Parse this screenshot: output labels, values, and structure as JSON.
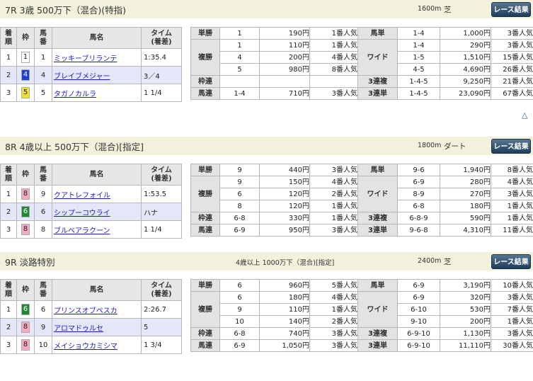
{
  "ui": {
    "result_button": "レース結果",
    "back_to_top": "△",
    "results_header": {
      "arrival": "着\n順",
      "frame": "枠",
      "horse_no": "馬\n番",
      "horse_name": "馬名",
      "time": "タイム\n(着差)"
    }
  },
  "races": [
    {
      "title": "7R 3歳 500万下（混合)(特指)",
      "conditions": "",
      "distance": "1600m",
      "surface": "芝",
      "results": [
        {
          "pos": "1",
          "frame": "1",
          "frame_color": "#ffffff",
          "frame_text_color": "#222222",
          "num": "1",
          "name": "ミッキーブリランテ",
          "time": "1:35.4"
        },
        {
          "pos": "2",
          "frame": "4",
          "frame_color": "#1c3fd6",
          "frame_text_color": "#ffffff",
          "num": "4",
          "name": "ブレイブメジャー",
          "time": "3／4"
        },
        {
          "pos": "3",
          "frame": "5",
          "frame_color": "#f5e12a",
          "frame_text_color": "#222222",
          "num": "5",
          "name": "タガノカルラ",
          "time": "1 1/4"
        }
      ],
      "payouts": {
        "tansho": {
          "label": "単勝",
          "rows": [
            {
              "combo": "1",
              "pay": "190円",
              "pop": "1番人気"
            }
          ]
        },
        "fukusho": {
          "label": "複勝",
          "rows": [
            {
              "combo": "1",
              "pay": "110円",
              "pop": "1番人気"
            },
            {
              "combo": "4",
              "pay": "200円",
              "pop": "4番人気"
            },
            {
              "combo": "5",
              "pay": "980円",
              "pop": "8番人気"
            }
          ]
        },
        "wakuren": {
          "label": "枠連",
          "rows": [
            {
              "combo": "",
              "pay": "",
              "pop": ""
            }
          ]
        },
        "umaren": {
          "label": "馬連",
          "rows": [
            {
              "combo": "1-4",
              "pay": "710円",
              "pop": "3番人気"
            }
          ]
        },
        "umatan": {
          "label": "馬単",
          "rows": [
            {
              "combo": "1-4",
              "pay": "1,000円",
              "pop": "3番人気"
            }
          ]
        },
        "wide": {
          "label": "ワイド",
          "rows": [
            {
              "combo": "1-4",
              "pay": "290円",
              "pop": "3番人気"
            },
            {
              "combo": "1-5",
              "pay": "1,510円",
              "pop": "15番人気"
            },
            {
              "combo": "4-5",
              "pay": "4,690円",
              "pop": "26番人気"
            }
          ]
        },
        "sanrenpuku": {
          "label": "3連複",
          "rows": [
            {
              "combo": "1-4-5",
              "pay": "9,250円",
              "pop": "21番人気"
            }
          ]
        },
        "sanrentan": {
          "label": "3連単",
          "rows": [
            {
              "combo": "1-4-5",
              "pay": "23,090円",
              "pop": "67番人気"
            }
          ]
        }
      }
    },
    {
      "title": "8R 4歳以上 500万下（混合)[指定]",
      "conditions": "",
      "distance": "1800m",
      "surface": "ダート",
      "results": [
        {
          "pos": "1",
          "frame": "8",
          "frame_color": "#f7a9bd",
          "frame_text_color": "#222222",
          "num": "9",
          "name": "クアトレフォイル",
          "time": "1:53.5"
        },
        {
          "pos": "2",
          "frame": "6",
          "frame_color": "#1d8a32",
          "frame_text_color": "#ffffff",
          "num": "6",
          "name": "シップーコウライ",
          "time": "ハナ"
        },
        {
          "pos": "3",
          "frame": "8",
          "frame_color": "#f7a9bd",
          "frame_text_color": "#222222",
          "num": "8",
          "name": "ブルベアラクーン",
          "time": "1 1/4"
        }
      ],
      "payouts": {
        "tansho": {
          "label": "単勝",
          "rows": [
            {
              "combo": "9",
              "pay": "440円",
              "pop": "3番人気"
            }
          ]
        },
        "fukusho": {
          "label": "複勝",
          "rows": [
            {
              "combo": "9",
              "pay": "150円",
              "pop": "4番人気"
            },
            {
              "combo": "6",
              "pay": "120円",
              "pop": "2番人気"
            },
            {
              "combo": "8",
              "pay": "120円",
              "pop": "1番人気"
            }
          ]
        },
        "wakuren": {
          "label": "枠連",
          "rows": [
            {
              "combo": "6-8",
              "pay": "330円",
              "pop": "1番人気"
            }
          ]
        },
        "umaren": {
          "label": "馬連",
          "rows": [
            {
              "combo": "6-9",
              "pay": "950円",
              "pop": "3番人気"
            }
          ]
        },
        "umatan": {
          "label": "馬単",
          "rows": [
            {
              "combo": "9-6",
              "pay": "1,940円",
              "pop": "8番人気"
            }
          ]
        },
        "wide": {
          "label": "ワイド",
          "rows": [
            {
              "combo": "6-9",
              "pay": "280円",
              "pop": "4番人気"
            },
            {
              "combo": "8-9",
              "pay": "270円",
              "pop": "3番人気"
            },
            {
              "combo": "6-8",
              "pay": "180円",
              "pop": "1番人気"
            }
          ]
        },
        "sanrenpuku": {
          "label": "3連複",
          "rows": [
            {
              "combo": "6-8-9",
              "pay": "590円",
              "pop": "1番人気"
            }
          ]
        },
        "sanrentan": {
          "label": "3連単",
          "rows": [
            {
              "combo": "9-6-8",
              "pay": "4,310円",
              "pop": "11番人気"
            }
          ]
        }
      }
    },
    {
      "title": "9R 淡路特別",
      "conditions": "4歳以上 1000万下（混合)[指定]",
      "distance": "2400m",
      "surface": "芝",
      "results": [
        {
          "pos": "1",
          "frame": "6",
          "frame_color": "#1d8a32",
          "frame_text_color": "#ffffff",
          "num": "6",
          "name": "プリンスオブペスカ",
          "time": "2:26.7"
        },
        {
          "pos": "2",
          "frame": "8",
          "frame_color": "#f7a9bd",
          "frame_text_color": "#222222",
          "num": "9",
          "name": "アロマドゥルセ",
          "time": "5"
        },
        {
          "pos": "3",
          "frame": "8",
          "frame_color": "#f7a9bd",
          "frame_text_color": "#222222",
          "num": "10",
          "name": "メイショウカミシマ",
          "time": "1 3/4"
        }
      ],
      "payouts": {
        "tansho": {
          "label": "単勝",
          "rows": [
            {
              "combo": "6",
              "pay": "960円",
              "pop": "5番人気"
            }
          ]
        },
        "fukusho": {
          "label": "複勝",
          "rows": [
            {
              "combo": "6",
              "pay": "180円",
              "pop": "4番人気"
            },
            {
              "combo": "9",
              "pay": "110円",
              "pop": "1番人気"
            },
            {
              "combo": "10",
              "pay": "140円",
              "pop": "2番人気"
            }
          ]
        },
        "wakuren": {
          "label": "枠連",
          "rows": [
            {
              "combo": "6-8",
              "pay": "740円",
              "pop": "3番人気"
            }
          ]
        },
        "umaren": {
          "label": "馬連",
          "rows": [
            {
              "combo": "6-9",
              "pay": "1,050円",
              "pop": "3番人気"
            }
          ]
        },
        "umatan": {
          "label": "馬単",
          "rows": [
            {
              "combo": "6-9",
              "pay": "3,190円",
              "pop": "10番人気"
            }
          ]
        },
        "wide": {
          "label": "ワイド",
          "rows": [
            {
              "combo": "6-9",
              "pay": "320円",
              "pop": "3番人気"
            },
            {
              "combo": "6-10",
              "pay": "530円",
              "pop": "7番人気"
            },
            {
              "combo": "9-10",
              "pay": "200円",
              "pop": "1番人気"
            }
          ]
        },
        "sanrenpuku": {
          "label": "3連複",
          "rows": [
            {
              "combo": "6-9-10",
              "pay": "1,130円",
              "pop": "3番人気"
            }
          ]
        },
        "sanrentan": {
          "label": "3連単",
          "rows": [
            {
              "combo": "6-9-10",
              "pay": "11,110円",
              "pop": "30番人気"
            }
          ]
        }
      }
    }
  ]
}
